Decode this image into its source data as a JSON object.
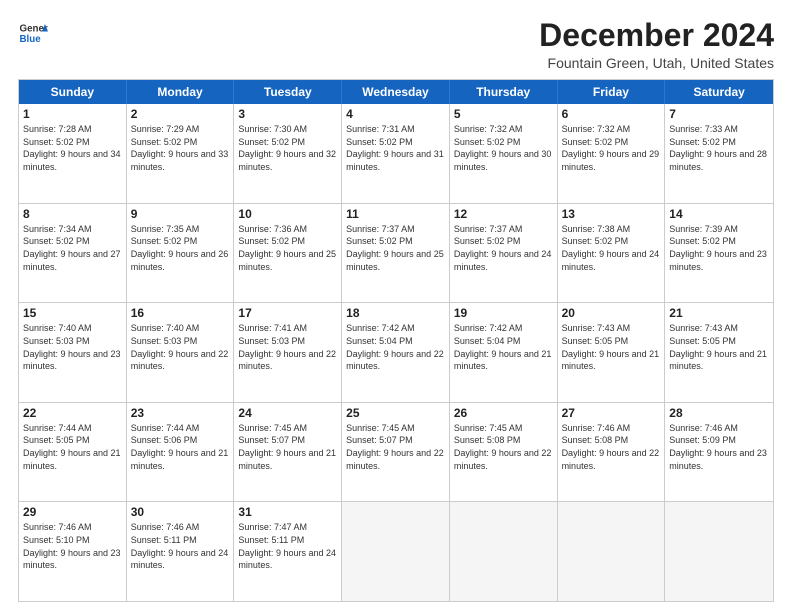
{
  "logo": {
    "line1": "General",
    "line2": "Blue"
  },
  "title": "December 2024",
  "location": "Fountain Green, Utah, United States",
  "days_of_week": [
    "Sunday",
    "Monday",
    "Tuesday",
    "Wednesday",
    "Thursday",
    "Friday",
    "Saturday"
  ],
  "rows": [
    [
      {
        "day": "1",
        "sunrise": "7:28 AM",
        "sunset": "5:02 PM",
        "daylight": "9 hours and 34 minutes."
      },
      {
        "day": "2",
        "sunrise": "7:29 AM",
        "sunset": "5:02 PM",
        "daylight": "9 hours and 33 minutes."
      },
      {
        "day": "3",
        "sunrise": "7:30 AM",
        "sunset": "5:02 PM",
        "daylight": "9 hours and 32 minutes."
      },
      {
        "day": "4",
        "sunrise": "7:31 AM",
        "sunset": "5:02 PM",
        "daylight": "9 hours and 31 minutes."
      },
      {
        "day": "5",
        "sunrise": "7:32 AM",
        "sunset": "5:02 PM",
        "daylight": "9 hours and 30 minutes."
      },
      {
        "day": "6",
        "sunrise": "7:32 AM",
        "sunset": "5:02 PM",
        "daylight": "9 hours and 29 minutes."
      },
      {
        "day": "7",
        "sunrise": "7:33 AM",
        "sunset": "5:02 PM",
        "daylight": "9 hours and 28 minutes."
      }
    ],
    [
      {
        "day": "8",
        "sunrise": "7:34 AM",
        "sunset": "5:02 PM",
        "daylight": "9 hours and 27 minutes."
      },
      {
        "day": "9",
        "sunrise": "7:35 AM",
        "sunset": "5:02 PM",
        "daylight": "9 hours and 26 minutes."
      },
      {
        "day": "10",
        "sunrise": "7:36 AM",
        "sunset": "5:02 PM",
        "daylight": "9 hours and 25 minutes."
      },
      {
        "day": "11",
        "sunrise": "7:37 AM",
        "sunset": "5:02 PM",
        "daylight": "9 hours and 25 minutes."
      },
      {
        "day": "12",
        "sunrise": "7:37 AM",
        "sunset": "5:02 PM",
        "daylight": "9 hours and 24 minutes."
      },
      {
        "day": "13",
        "sunrise": "7:38 AM",
        "sunset": "5:02 PM",
        "daylight": "9 hours and 24 minutes."
      },
      {
        "day": "14",
        "sunrise": "7:39 AM",
        "sunset": "5:02 PM",
        "daylight": "9 hours and 23 minutes."
      }
    ],
    [
      {
        "day": "15",
        "sunrise": "7:40 AM",
        "sunset": "5:03 PM",
        "daylight": "9 hours and 23 minutes."
      },
      {
        "day": "16",
        "sunrise": "7:40 AM",
        "sunset": "5:03 PM",
        "daylight": "9 hours and 22 minutes."
      },
      {
        "day": "17",
        "sunrise": "7:41 AM",
        "sunset": "5:03 PM",
        "daylight": "9 hours and 22 minutes."
      },
      {
        "day": "18",
        "sunrise": "7:42 AM",
        "sunset": "5:04 PM",
        "daylight": "9 hours and 22 minutes."
      },
      {
        "day": "19",
        "sunrise": "7:42 AM",
        "sunset": "5:04 PM",
        "daylight": "9 hours and 21 minutes."
      },
      {
        "day": "20",
        "sunrise": "7:43 AM",
        "sunset": "5:05 PM",
        "daylight": "9 hours and 21 minutes."
      },
      {
        "day": "21",
        "sunrise": "7:43 AM",
        "sunset": "5:05 PM",
        "daylight": "9 hours and 21 minutes."
      }
    ],
    [
      {
        "day": "22",
        "sunrise": "7:44 AM",
        "sunset": "5:05 PM",
        "daylight": "9 hours and 21 minutes."
      },
      {
        "day": "23",
        "sunrise": "7:44 AM",
        "sunset": "5:06 PM",
        "daylight": "9 hours and 21 minutes."
      },
      {
        "day": "24",
        "sunrise": "7:45 AM",
        "sunset": "5:07 PM",
        "daylight": "9 hours and 21 minutes."
      },
      {
        "day": "25",
        "sunrise": "7:45 AM",
        "sunset": "5:07 PM",
        "daylight": "9 hours and 22 minutes."
      },
      {
        "day": "26",
        "sunrise": "7:45 AM",
        "sunset": "5:08 PM",
        "daylight": "9 hours and 22 minutes."
      },
      {
        "day": "27",
        "sunrise": "7:46 AM",
        "sunset": "5:08 PM",
        "daylight": "9 hours and 22 minutes."
      },
      {
        "day": "28",
        "sunrise": "7:46 AM",
        "sunset": "5:09 PM",
        "daylight": "9 hours and 23 minutes."
      }
    ],
    [
      {
        "day": "29",
        "sunrise": "7:46 AM",
        "sunset": "5:10 PM",
        "daylight": "9 hours and 23 minutes."
      },
      {
        "day": "30",
        "sunrise": "7:46 AM",
        "sunset": "5:11 PM",
        "daylight": "9 hours and 24 minutes."
      },
      {
        "day": "31",
        "sunrise": "7:47 AM",
        "sunset": "5:11 PM",
        "daylight": "9 hours and 24 minutes."
      },
      null,
      null,
      null,
      null
    ]
  ]
}
